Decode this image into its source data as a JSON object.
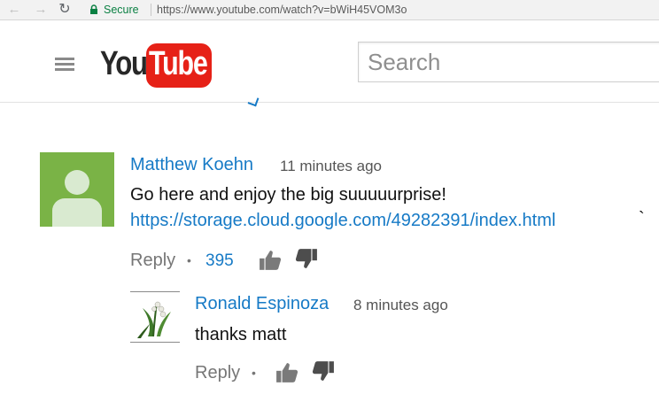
{
  "browser": {
    "secure_label": "Secure",
    "url": "https://www.youtube.com/watch?v=bWiH45VOM3o"
  },
  "header": {
    "logo_you": "You",
    "logo_tube": "Tube",
    "search_placeholder": "Search"
  },
  "comments": [
    {
      "author": "Matthew Koehn",
      "time": "11 minutes ago",
      "text": "Go here and enjoy the big suuuuurprise!",
      "link": "https://storage.cloud.google.com/49282391/index.html",
      "trailing": "`",
      "reply_label": "Reply",
      "separator": "•",
      "likes": "395",
      "avatar_color": "#7ab346"
    },
    {
      "author": "Ronald Espinoza",
      "time": "8 minutes ago",
      "text": "thanks matt",
      "reply_label": "Reply",
      "separator": "•"
    }
  ],
  "colors": {
    "link_blue": "#167ac6",
    "youtube_red": "#e62117",
    "secure_green": "#0b8043"
  }
}
